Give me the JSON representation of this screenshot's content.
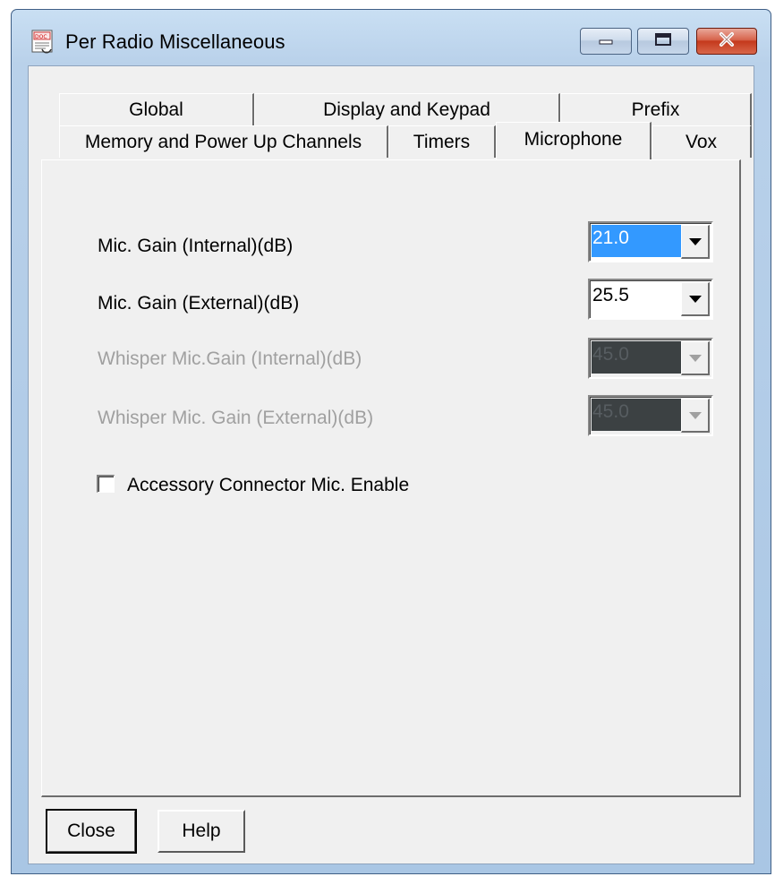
{
  "window": {
    "title": "Per Radio Miscellaneous",
    "icon": "document-icon"
  },
  "caption_buttons": [
    "minimize-icon",
    "maximize-icon",
    "close-icon"
  ],
  "tabs": {
    "row_back": [
      {
        "label": "Global"
      },
      {
        "label": "Display and Keypad"
      },
      {
        "label": "Prefix"
      }
    ],
    "row_front": [
      {
        "label": "Memory and Power Up Channels"
      },
      {
        "label": "Timers"
      },
      {
        "label": "Microphone",
        "active": true
      },
      {
        "label": "Vox"
      }
    ]
  },
  "microphone": {
    "fields": [
      {
        "label": "Mic. Gain (Internal)(dB)",
        "value": "21.0",
        "enabled": true,
        "selected": true
      },
      {
        "label": "Mic. Gain (External)(dB)",
        "value": "25.5",
        "enabled": true,
        "selected": false
      },
      {
        "label": "Whisper Mic.Gain (Internal)(dB)",
        "value": "45.0",
        "enabled": false
      },
      {
        "label": "Whisper Mic. Gain (External)(dB)",
        "value": "45.0",
        "enabled": false
      }
    ],
    "accessory_checkbox": {
      "label": "Accessory Connector Mic. Enable",
      "checked": false
    }
  },
  "buttons": {
    "close": "Close",
    "help": "Help"
  },
  "colors": {
    "selection": "#3399ff",
    "disabled_text": "#a0a0a0",
    "dialog_bg": "#f0f0f0"
  }
}
